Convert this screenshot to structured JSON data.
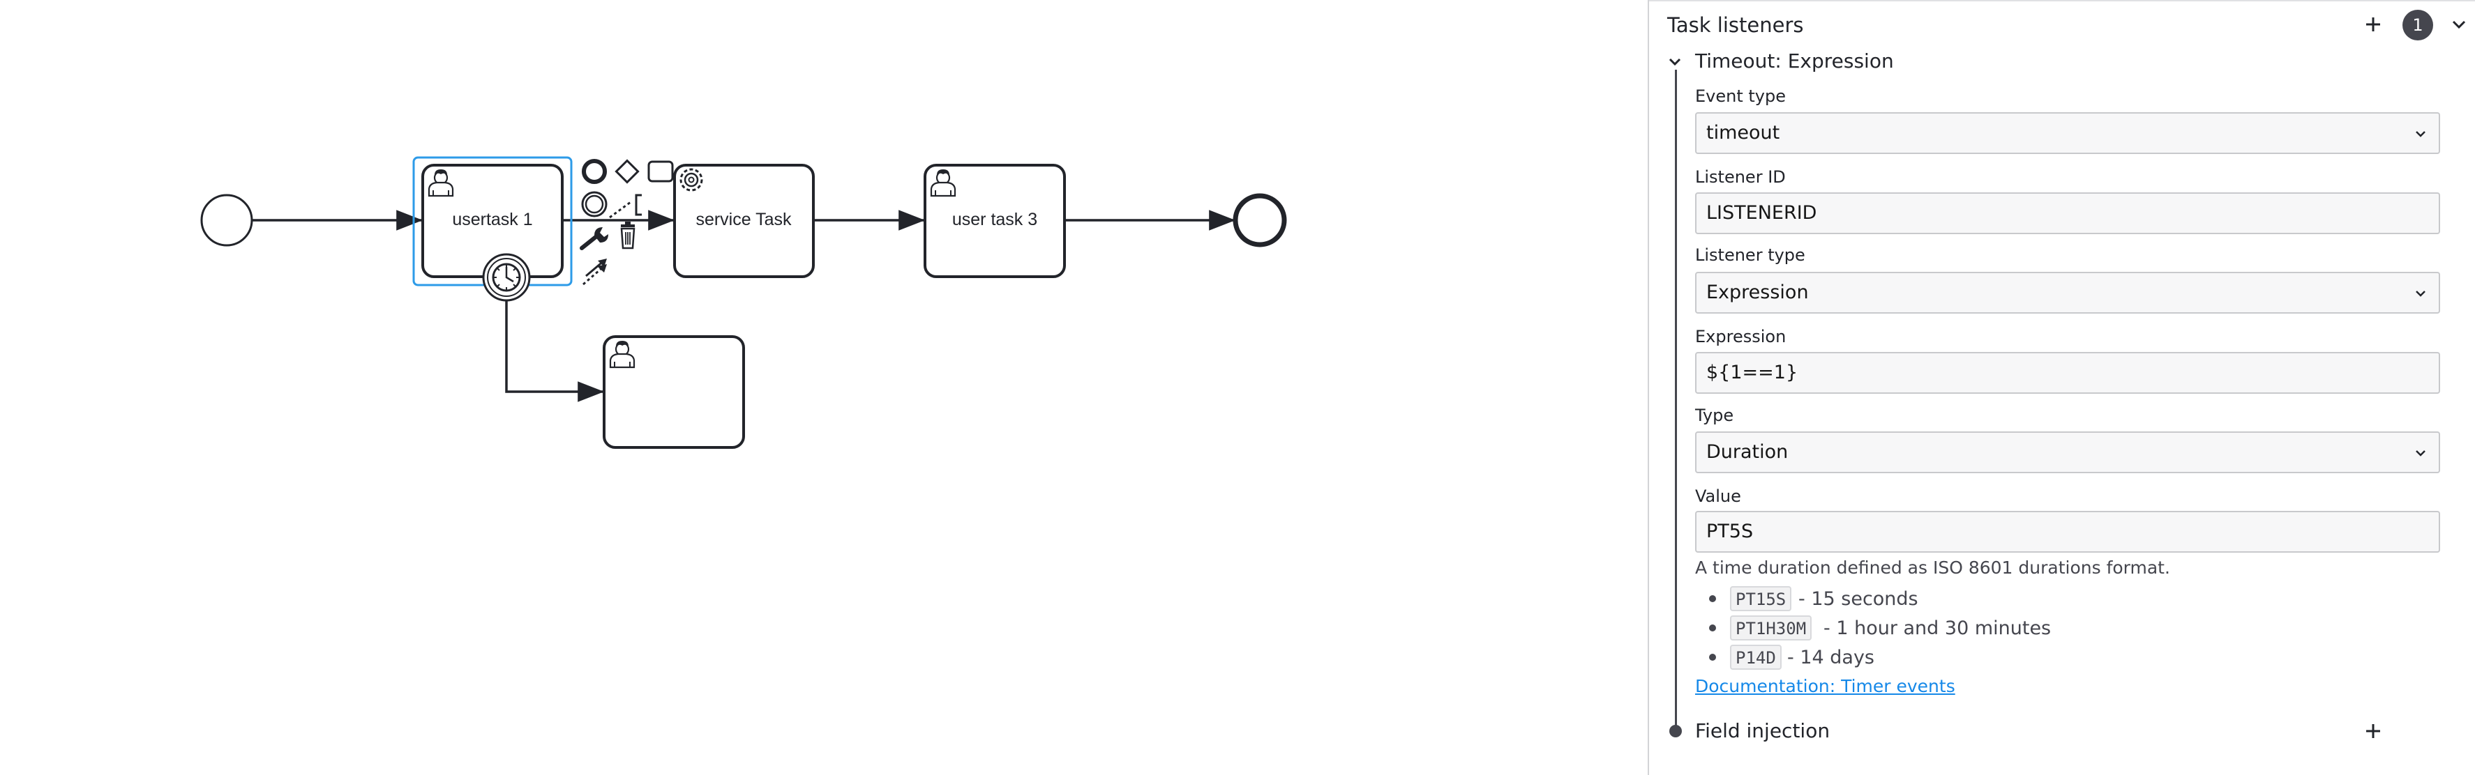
{
  "diagram": {
    "nodes": {
      "start_event": {
        "label": ""
      },
      "usertask_1": {
        "label": "usertask 1"
      },
      "service_task": {
        "label": "service Task"
      },
      "user_task_3": {
        "label": "user task 3"
      },
      "user_task_unnamed": {
        "label": ""
      },
      "end_event": {
        "label": ""
      }
    },
    "selected": "usertask_1",
    "colors": {
      "stroke": "#22242a",
      "selection": "#2d9be8",
      "fill": "#ffffff"
    },
    "context_pad": [
      "end-event-icon",
      "gateway-icon",
      "task-icon",
      "intermediate-event-icon",
      "text-annotation-icon",
      "connect-icon",
      "wrench-icon",
      "trash-icon",
      "append-arrow-icon"
    ]
  },
  "panel": {
    "group_title": "Task listeners",
    "count": "1",
    "entry_title": "Timeout: Expression",
    "fields": {
      "event_type": {
        "label": "Event type",
        "value": "timeout"
      },
      "listener_id": {
        "label": "Listener ID",
        "value": "LISTENERID"
      },
      "listener_type": {
        "label": "Listener type",
        "value": "Expression"
      },
      "expression": {
        "label": "Expression",
        "value": "${1==1}"
      },
      "type": {
        "label": "Type",
        "value": "Duration"
      },
      "value": {
        "label": "Value",
        "value": "PT5S"
      }
    },
    "help": {
      "description": "A time duration defined as ISO 8601 durations format.",
      "examples": [
        {
          "code": "PT15S",
          "desc": "- 15 seconds"
        },
        {
          "code": "PT1H30M",
          "desc": "- 1 hour and 30 minutes"
        },
        {
          "code": "P14D",
          "desc": "- 14 days"
        }
      ],
      "doc_link": "Documentation: Timer events"
    },
    "field_injection": "Field injection",
    "colors": {
      "link": "#1588e8",
      "badge": "#45464e"
    }
  }
}
